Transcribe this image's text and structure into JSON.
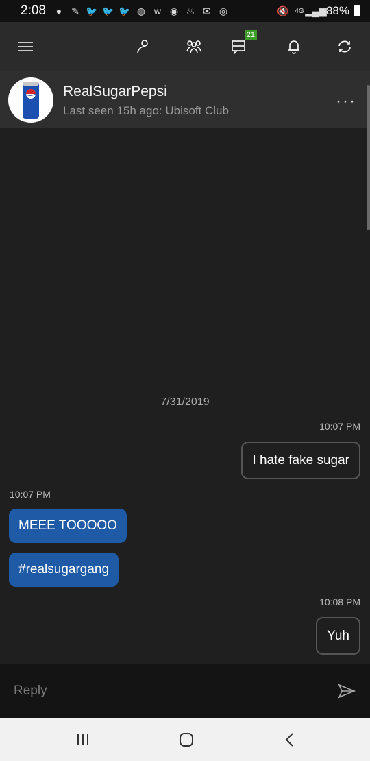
{
  "status_bar": {
    "time": "2:08",
    "battery": "88%",
    "notification_icons": [
      "chat-icon",
      "pen-icon",
      "twitter-icon",
      "twitter-icon",
      "twitter-icon",
      "globe-icon",
      "w-icon",
      "pocket-icon",
      "flame-icon",
      "mail-icon",
      "sync-icon"
    ],
    "system_icons": [
      "mute-icon",
      "4g-icon",
      "signal-icon"
    ]
  },
  "toolbar": {
    "badge_count": "21"
  },
  "contact": {
    "name": "RealSugarPepsi",
    "status": "Last seen 15h ago: Ubisoft Club"
  },
  "chat": {
    "date": "7/31/2019",
    "messages": [
      {
        "time": "10:07 PM",
        "text": "I hate fake sugar",
        "direction": "out"
      },
      {
        "time": "10:07 PM",
        "text": "MEEE TOOOOO",
        "direction": "in"
      },
      {
        "time": "",
        "text": "#realsugargang",
        "direction": "in"
      },
      {
        "time": "10:08 PM",
        "text": "Yuh",
        "direction": "out"
      }
    ]
  },
  "reply": {
    "placeholder": "Reply"
  },
  "colors": {
    "incoming_bubble": "#1e5aa6",
    "badge": "#3c9b29",
    "background": "#1f1f1f"
  }
}
